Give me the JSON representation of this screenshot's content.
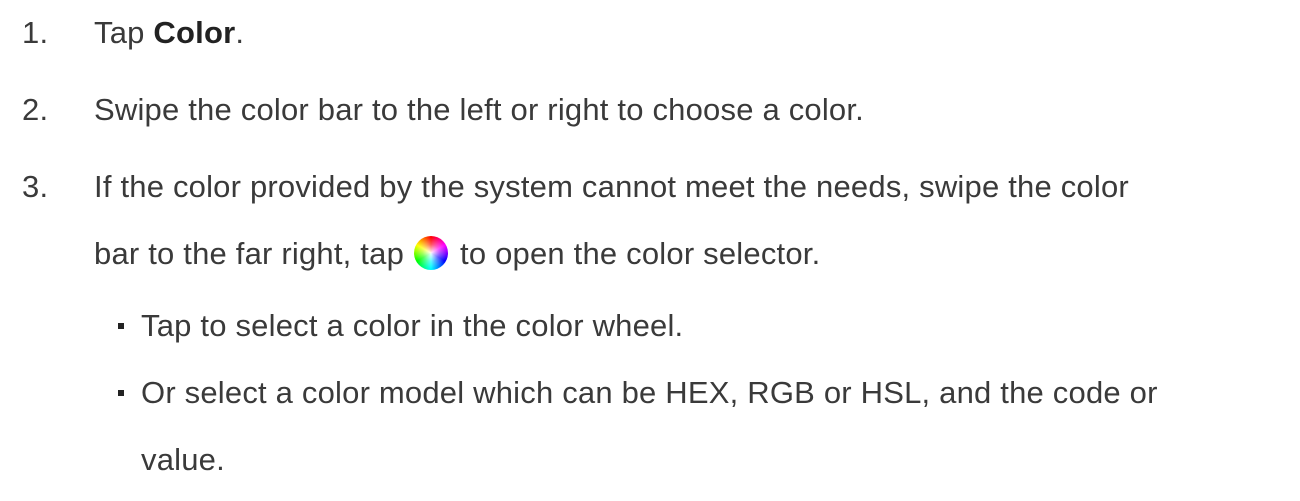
{
  "steps": [
    {
      "number": "1.",
      "prefix": "Tap ",
      "bold": "Color",
      "suffix": "."
    },
    {
      "number": "2.",
      "text": "Swipe the color bar to the left or right to choose a color."
    },
    {
      "number": "3.",
      "line1": "If the color provided by the system cannot meet the needs, swipe the color",
      "line2_before_icon": "bar to the far right, tap",
      "icon": "color-wheel-icon",
      "line2_after_icon": "to open the color selector."
    }
  ],
  "sub_items": [
    {
      "line1": "Tap to select a color in the color wheel."
    },
    {
      "line1": "Or select a color model which can be HEX, RGB or HSL, and the code or",
      "line2": "value."
    }
  ]
}
